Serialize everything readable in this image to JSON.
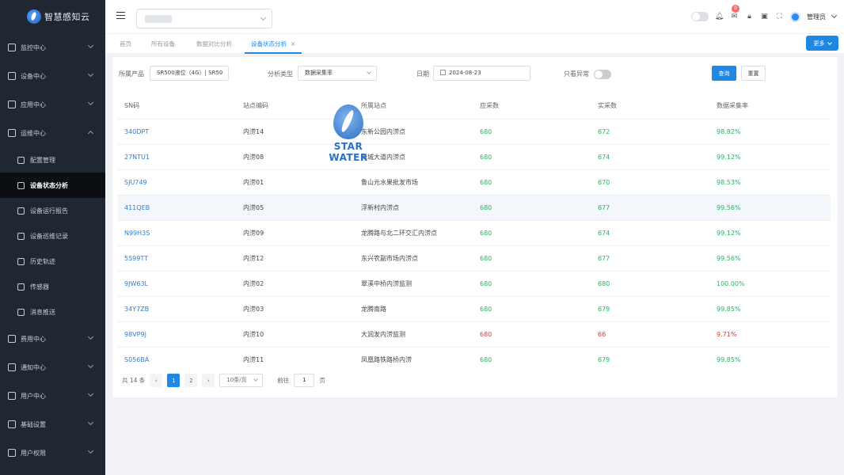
{
  "app": {
    "title": "智慧感知云"
  },
  "sidebar": {
    "items": [
      {
        "label": "监控中心",
        "icon": "monitor-icon"
      },
      {
        "label": "设备中心",
        "icon": "device-icon"
      },
      {
        "label": "应用中心",
        "icon": "apps-icon"
      },
      {
        "label": "运维中心",
        "icon": "ops-icon",
        "expanded": true
      },
      {
        "label": "费用中心",
        "icon": "fee-icon"
      },
      {
        "label": "通知中心",
        "icon": "bell-icon"
      },
      {
        "label": "用户中心",
        "icon": "user-icon"
      },
      {
        "label": "基础设置",
        "icon": "settings-icon"
      },
      {
        "label": "用户权限",
        "icon": "permission-icon"
      }
    ],
    "sub_items": [
      {
        "label": "配置管理"
      },
      {
        "label": "设备状态分析"
      },
      {
        "label": "设备运行报告"
      },
      {
        "label": "设备巡维记录"
      },
      {
        "label": "历史轨迹"
      },
      {
        "label": "传感器"
      },
      {
        "label": "消息推送"
      }
    ]
  },
  "header": {
    "notification_count": "0",
    "user_name": "管理员"
  },
  "tabs": [
    {
      "label": "首页"
    },
    {
      "label": "所有设备"
    },
    {
      "label": "数据对比分析"
    },
    {
      "label": "设备状态分析",
      "close": "×"
    }
  ],
  "more_button": "更多",
  "filters": {
    "product_label": "所属产品",
    "product_value": "SR500液位（4G）| SR50",
    "type_label": "分析类型",
    "type_value": "数据采集率",
    "date_label": "日期",
    "date_value": "2024-08-23",
    "abnormal_label": "只看异常",
    "query_button": "查询",
    "reset_button": "重置"
  },
  "watermark": {
    "text": "STAR WATER"
  },
  "table": {
    "headers": [
      "SN码",
      "站点编码",
      "所属站点",
      "应采数",
      "实采数",
      "数据采集率"
    ],
    "rows": [
      {
        "sn": "340DPT",
        "code": "内涝14",
        "site": "东新公园内涝点",
        "expected": "680",
        "actual": "672",
        "rate": "98.82%",
        "ok": true
      },
      {
        "sn": "27NTU1",
        "code": "内涝08",
        "site": "新城大道内涝点",
        "expected": "680",
        "actual": "674",
        "rate": "99.12%",
        "ok": true
      },
      {
        "sn": "SJU749",
        "code": "内涝01",
        "site": "鲁山元水果批发市场",
        "expected": "680",
        "actual": "670",
        "rate": "98.53%",
        "ok": true
      },
      {
        "sn": "411QEB",
        "code": "内涝05",
        "site": "浮新村内涝点",
        "expected": "680",
        "actual": "677",
        "rate": "99.56%",
        "ok": true
      },
      {
        "sn": "N99H3S",
        "code": "内涝09",
        "site": "龙腾路与北二环交汇内涝点",
        "expected": "680",
        "actual": "674",
        "rate": "99.12%",
        "ok": true
      },
      {
        "sn": "5S99TT",
        "code": "内涝12",
        "site": "东兴农副市场内涝点",
        "expected": "680",
        "actual": "677",
        "rate": "99.56%",
        "ok": true
      },
      {
        "sn": "9JW63L",
        "code": "内涝02",
        "site": "翠溪中桥内涝监测",
        "expected": "680",
        "actual": "680",
        "rate": "100.00%",
        "ok": true
      },
      {
        "sn": "34Y7ZB",
        "code": "内涝03",
        "site": "龙腾南路",
        "expected": "680",
        "actual": "679",
        "rate": "99.85%",
        "ok": true
      },
      {
        "sn": "98VP9J",
        "code": "内涝10",
        "site": "大润发内涝监测",
        "expected": "680",
        "actual": "66",
        "rate": "9.71%",
        "ok": false
      },
      {
        "sn": "S056BA",
        "code": "内涝11",
        "site": "凤凰路铁路桥内涝",
        "expected": "680",
        "actual": "679",
        "rate": "99.85%",
        "ok": true
      }
    ]
  },
  "pagination": {
    "total": "共 14 条",
    "pages": [
      "1",
      "2"
    ],
    "current_page": "1",
    "page_size": "10条/页",
    "goto_label": "前往",
    "goto_value": "1",
    "goto_suffix": "页",
    "prev": "‹",
    "next": "›"
  },
  "colors": {
    "accent": "#1e88e5",
    "ok": "#27b463",
    "bad": "#e03c3c",
    "sidebar": "#1f2733"
  }
}
